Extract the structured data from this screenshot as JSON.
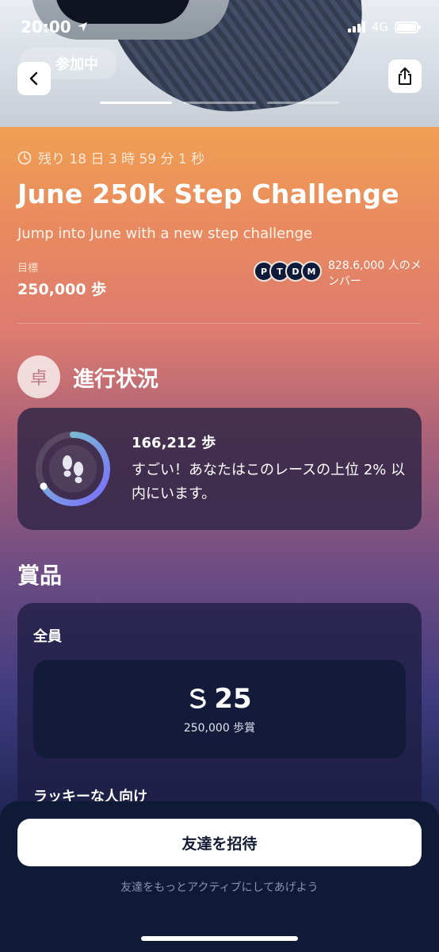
{
  "status_bar": {
    "time": "20:00",
    "network": "4G"
  },
  "hero": {
    "joined_label": "参加中"
  },
  "challenge": {
    "timer": "残り 18 日 3 時 59 分 1 秒",
    "title": "June 250k Step Challenge",
    "subtitle": "Jump into June with a new step challenge",
    "goal_label": "目標",
    "goal_value": "250,000 歩",
    "member_initials": [
      "P",
      "T",
      "D",
      "M"
    ],
    "members_text": "828.6,000 人のメンバー"
  },
  "progress": {
    "section_icon_char": "卓",
    "title": "進行状況",
    "steps": "166,212 歩",
    "message": "すごい！あなたはこのレースの上位 2% 以内にいます。",
    "fraction": 0.665
  },
  "prizes": {
    "title": "賞品",
    "tier1_label": "全員",
    "reward_amount": "25",
    "reward_sub": "250,000 歩賞",
    "tier2_label": "ラッキーな人向け"
  },
  "bottom": {
    "invite_label": "友達を招待",
    "invite_sub": "友達をもっとアクティブにしてあげよう"
  },
  "colors": {
    "ring_start": "#7ad1c4",
    "ring_end": "#7a6cff",
    "accent_orange": "#f0a252"
  },
  "icons": [
    "location-arrow-icon",
    "signal-icon",
    "battery-icon",
    "back-chevron-icon",
    "share-icon",
    "clock-icon",
    "footsteps-icon",
    "coin-icon"
  ]
}
